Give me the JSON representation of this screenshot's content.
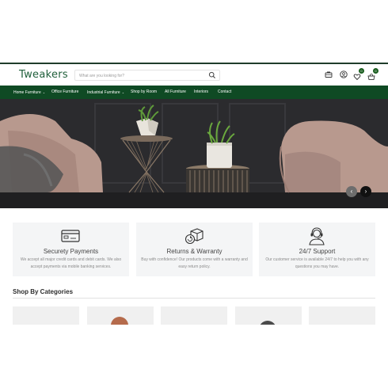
{
  "header": {
    "logo": "Tweakers",
    "search": {
      "placeholder": "What are you looking for?"
    },
    "icons": [
      {
        "name": "briefcase-icon"
      },
      {
        "name": "user-icon"
      },
      {
        "name": "heart-icon",
        "badge": "0"
      },
      {
        "name": "cart-icon",
        "badge": "0"
      }
    ]
  },
  "nav": {
    "items": [
      {
        "label": "Home Furniture",
        "has_dropdown": true
      },
      {
        "label": "Office Furniture",
        "has_dropdown": false
      },
      {
        "label": "Industrial Furniture",
        "has_dropdown": true
      },
      {
        "label": "Shop by Room",
        "has_dropdown": false
      },
      {
        "label": "All Furniture",
        "has_dropdown": false
      },
      {
        "label": "Interiors",
        "has_dropdown": false
      },
      {
        "label": "Contact",
        "has_dropdown": false
      }
    ]
  },
  "hero": {
    "prev_icon": "chevron-left-icon",
    "next_icon": "chevron-right-icon",
    "prev_glyph": "‹",
    "next_glyph": "›"
  },
  "features": [
    {
      "icon": "credit-card-icon",
      "title": "Securety Payments",
      "desc": "We accept all major credit cards and debit cards. We also accept payments via mobile banking services."
    },
    {
      "icon": "returns-box-icon",
      "title": "Returns & Warranty",
      "desc": "Buy with confidence! Our products come with a warranty and easy return policy."
    },
    {
      "icon": "support-agent-icon",
      "title": "24/7 Support",
      "desc": "Our customer service is available 24/7 to help you with any questions you may have."
    }
  ],
  "categories": {
    "title": "Shop By Categories"
  },
  "colors": {
    "brand_green": "#0f4a24",
    "logo_green": "#1f5f3a",
    "feature_bg": "#f4f5f6"
  }
}
